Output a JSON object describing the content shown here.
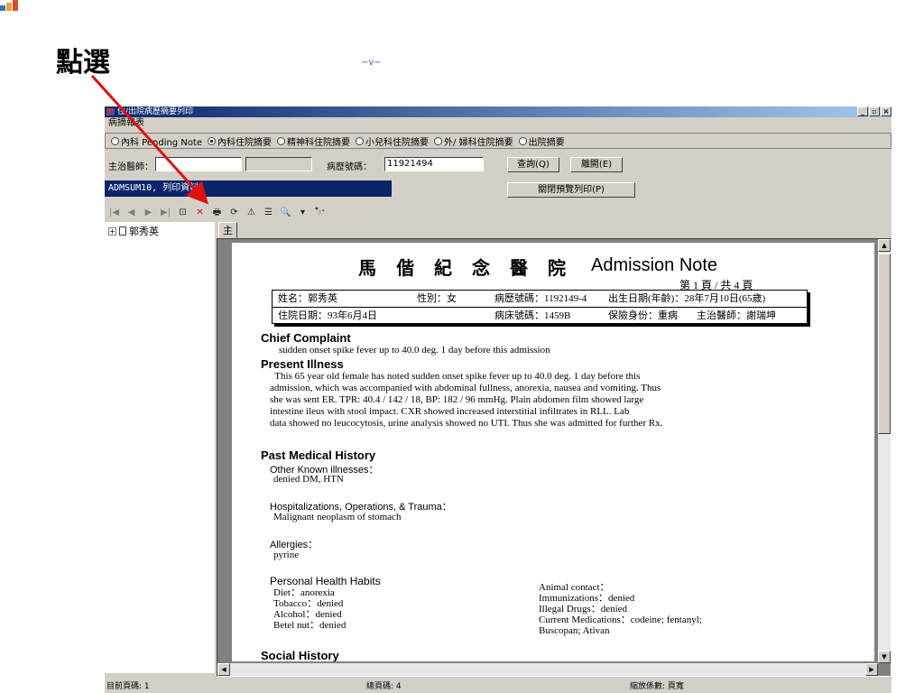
{
  "annotation": {
    "label": "點選",
    "squiggle": "~v~"
  },
  "window": {
    "title": "住/出院病歷摘要列印",
    "menu": "病摘報表",
    "min_glyph": "_",
    "max_glyph": "▫",
    "close_glyph": "×"
  },
  "radios": [
    {
      "label": "內科 Pending Note",
      "selected": false
    },
    {
      "label": "內科住院摘要",
      "selected": true
    },
    {
      "label": "精神科住院摘要",
      "selected": false
    },
    {
      "label": "小兒科住院摘要",
      "selected": false
    },
    {
      "label": "外/ 婦科住院摘要",
      "selected": false
    },
    {
      "label": "出院摘要",
      "selected": false
    }
  ],
  "form": {
    "doctor_label": "主治醫師：",
    "doctor_value": "",
    "record_label": "病歷號碼：",
    "record_value": "11921494",
    "query_button": "查詢(Q)",
    "leave_button": "離開(E)",
    "close_preview_button": "關閉預覽列印(P)"
  },
  "status_message": "ADMSUM10, 列印資料。",
  "toolbar": [
    "|◀",
    "◀",
    "▶",
    "▶|",
    "⊡",
    "✕",
    "🖶",
    "⟳",
    "⚠",
    "☰",
    "🔍",
    "▾",
    "🔭"
  ],
  "tree": {
    "patient": "郭秀英"
  },
  "tab": "主報表",
  "report": {
    "hospital": "馬偕紀念醫院",
    "title_en": "Admission Note",
    "page_label": "第 1 頁 / 共 4 頁",
    "row1": {
      "name": "姓名：郭秀英",
      "sex": "性別：女",
      "record_no": "病歷號碼：1192149-4",
      "birth": "出生日期(年齡)：28年7月10日(65歲)"
    },
    "row2": {
      "admit_date": "住院日期：93年6月4日",
      "bed": "病床號碼：1459B",
      "insurance": "保險身份：重病",
      "doctor": "主治醫師：謝瑞坤"
    },
    "chief_complaint_h": "Chief Complaint",
    "chief_complaint": "sudden onset spike fever up to 40.0 deg. 1 day before this admission",
    "present_illness_h": "Present Illness",
    "present_illness": [
      "  This 65 year old female has noted sudden onset spike fever up to 40.0 deg. 1 day before this",
      "admission, which was accompanied with abdominal fullness, anorexia, nausea and vomiting. Thus",
      "she was sent ER. TPR: 40.4 / 142 / 18, BP: 182 / 96 mmHg. Plain abdomen film showed large",
      "intestine ileus with stool impact. CXR showed increased interstitial infiltrates in RLL. Lab",
      "data showed no leucocytosis, urine analysis showed no UTI. Thus she was admitted for further Rx."
    ],
    "past_history_h": "Past Medical History",
    "other_illness_h": "Other Known illnesses：",
    "other_illness": "denied DM, HTN",
    "hospitalizations_h": "Hospitalizations, Operations, & Trauma：",
    "hospitalizations": "Malignant neoplasm of stomach",
    "allergies_h": "Allergies：",
    "allergies": "pyrine",
    "habits_h": "Personal Health Habits",
    "habits_left": [
      "Diet：anorexia",
      "Tobacco：denied",
      "Alcohol：denied",
      "Betel nut：denied"
    ],
    "habits_right": [
      "Animal contact：",
      "Immunizations：denied",
      "Illegal Drugs：denied",
      "Current Medications：codeine; fentanyl;",
      "Buscopan; Ativan"
    ],
    "social_h": "Social History"
  },
  "statusbar": {
    "current_page": "目前頁碼: 1",
    "total_pages": "總頁碼: 4",
    "zoom": "縮放係數: 頁寬"
  }
}
